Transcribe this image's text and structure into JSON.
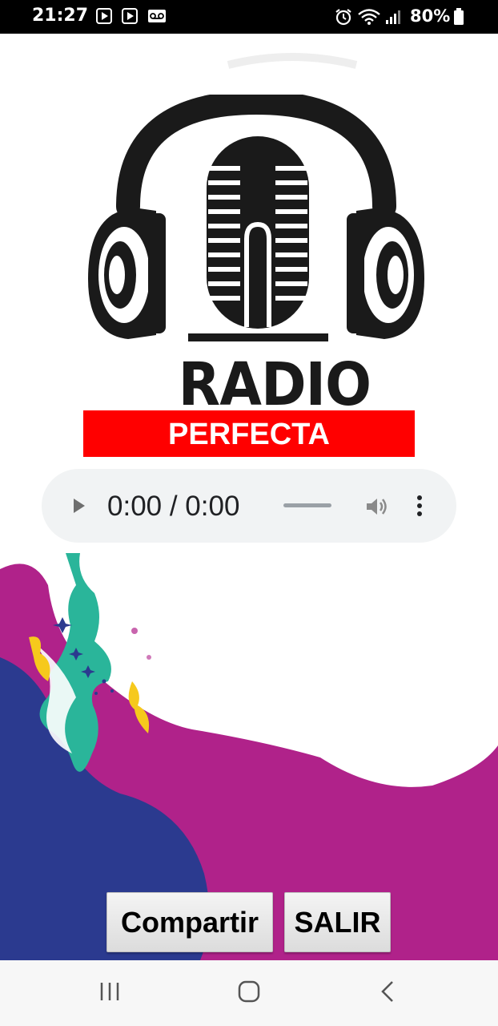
{
  "status_bar": {
    "time": "21:27",
    "battery": "80%",
    "icons": [
      "youtube-icon",
      "youtube-icon",
      "voicemail-icon",
      "alarm-icon",
      "wifi-icon",
      "signal-icon",
      "battery-icon"
    ]
  },
  "logo": {
    "word": "RADIO",
    "band_text": "PERFECTA",
    "band_color": "#ff0000"
  },
  "player": {
    "time": "0:00 / 0:00",
    "play_icon": "play-icon",
    "volume_icon": "volume-icon",
    "menu_icon": "more-vert-icon",
    "progress": 0
  },
  "buttons": {
    "share_label": "Compartir",
    "exit_label": "SALIR"
  },
  "nav_bar": {
    "icons": [
      "recent-apps-icon",
      "home-icon",
      "back-icon"
    ]
  },
  "colors": {
    "magenta": "#b0228a",
    "navy": "#2b3a8f",
    "teal": "#2ab59a",
    "yellow": "#f6c91c"
  }
}
